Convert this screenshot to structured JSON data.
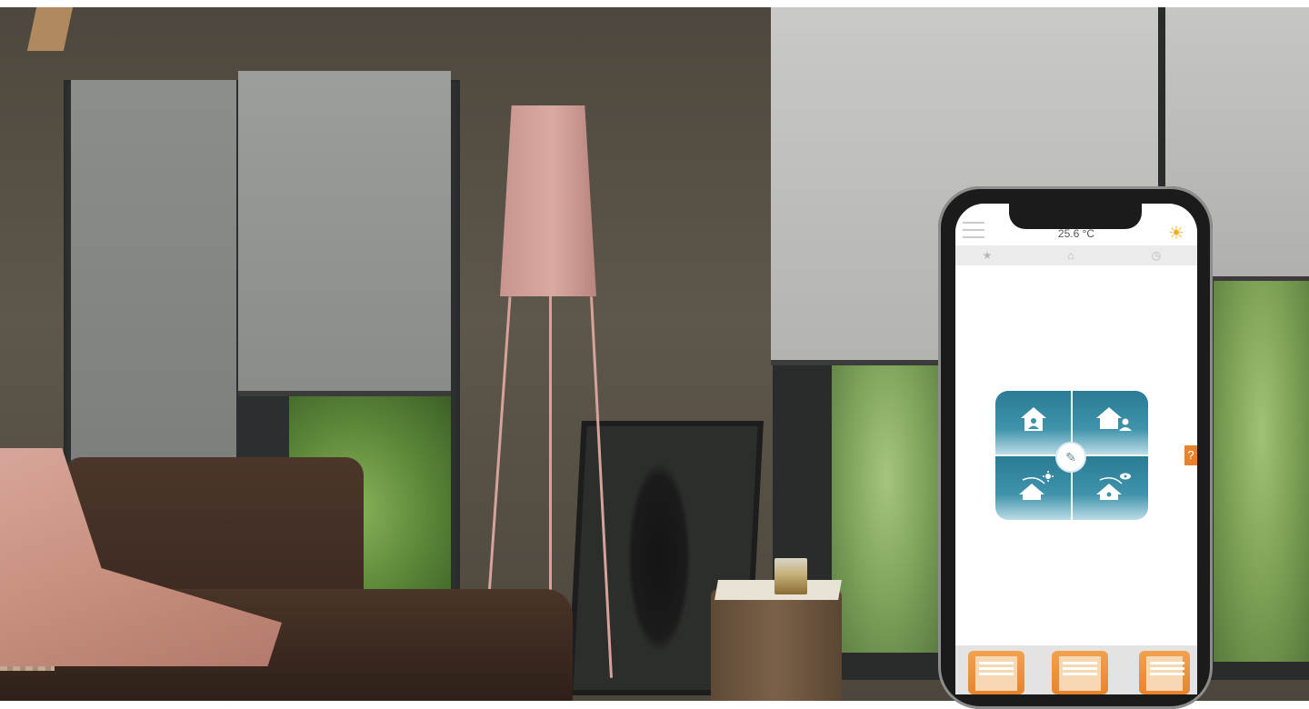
{
  "app": {
    "status": {
      "temperature": "25.6 °C"
    },
    "icons": {
      "menu": "hamburger-menu-icon",
      "weather": "sun-icon",
      "tab_favorites": "star-icon",
      "tab_rooms": "room-icon",
      "tab_timer": "clock-icon",
      "edit": "pencil-icon",
      "help": "question-icon"
    },
    "scenes": [
      {
        "icon": "house-person-inside-icon"
      },
      {
        "icon": "house-person-away-icon"
      },
      {
        "icon": "house-sun-icon"
      },
      {
        "icon": "house-eye-icon"
      }
    ],
    "controls": [
      {
        "icon": "blind-down-icon"
      },
      {
        "icon": "blind-up-icon"
      },
      {
        "icon": "curtain-open-icon"
      }
    ],
    "help_label": "?",
    "colors": {
      "accent": "#e8832b",
      "scene_tile": "#2a7b95",
      "sun": "#f2b123"
    }
  }
}
